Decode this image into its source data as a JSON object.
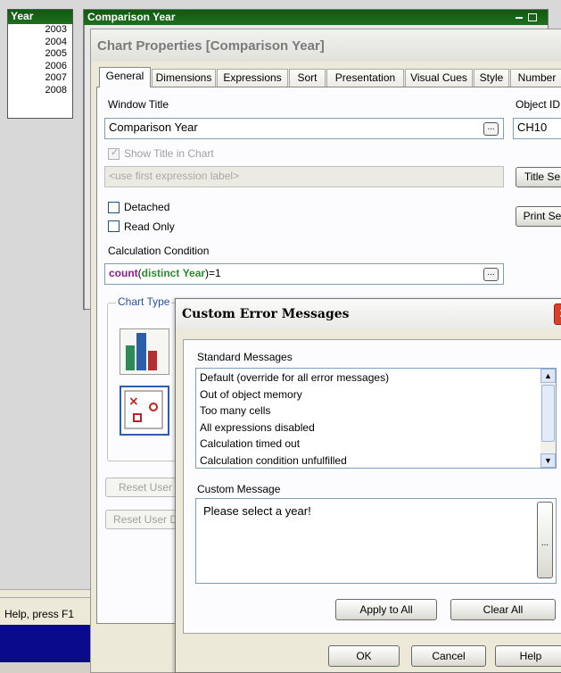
{
  "year_listbox": {
    "title": "Year",
    "items": [
      "2003",
      "2004",
      "2005",
      "2006",
      "2007",
      "2008"
    ]
  },
  "sheet_object": {
    "title": "Comparison Year"
  },
  "status_bar": {
    "help_text": "Help, press F1"
  },
  "chart_properties": {
    "title": "Chart Properties [Comparison Year]",
    "tabs": [
      "General",
      "Dimensions",
      "Expressions",
      "Sort",
      "Presentation",
      "Visual Cues",
      "Style",
      "Number"
    ],
    "active_tab": "General",
    "window_title_label": "Window Title",
    "window_title_value": "Comparison Year",
    "object_id_label": "Object ID",
    "object_id_value": "CH10",
    "show_title_label": "Show Title in Chart",
    "show_title_checked": true,
    "title_expression_placeholder": "<use first expression label>",
    "title_settings_button": "Title Se",
    "print_settings_button": "Print Se",
    "detached_label": "Detached",
    "read_only_label": "Read Only",
    "calc_condition_label": "Calculation Condition",
    "calc_condition": {
      "func": "count",
      "open": "(",
      "keyword": "distinct",
      "field": "Year",
      "rest": ")=1"
    },
    "chart_type_label": "Chart Type",
    "reset_user_sizes_button": "Reset User",
    "reset_user_docking_button": "Reset User D",
    "ellipsis": "..."
  },
  "custom_error_dialog": {
    "title": "Custom Error Messages",
    "standard_messages_label": "Standard Messages",
    "messages": [
      "Default (override for all error messages)",
      "Out of object memory",
      "Too many cells",
      "All expressions disabled",
      "Calculation timed out",
      "Calculation condition unfulfilled"
    ],
    "custom_message_label": "Custom Message",
    "custom_message_value": "Please select a year!",
    "apply_to_all_button": "Apply to All",
    "clear_all_button": "Clear All",
    "ok_button": "OK",
    "cancel_button": "Cancel",
    "help_button": "Help",
    "ellipsis": "..."
  },
  "colors": {
    "qv_green_title": "#1a6a1a",
    "dialog_close": "#d9412b",
    "taskbar": "#0a0a8c",
    "calc_func": "#8b1a8b",
    "calc_keyword": "#2e8b2e"
  }
}
